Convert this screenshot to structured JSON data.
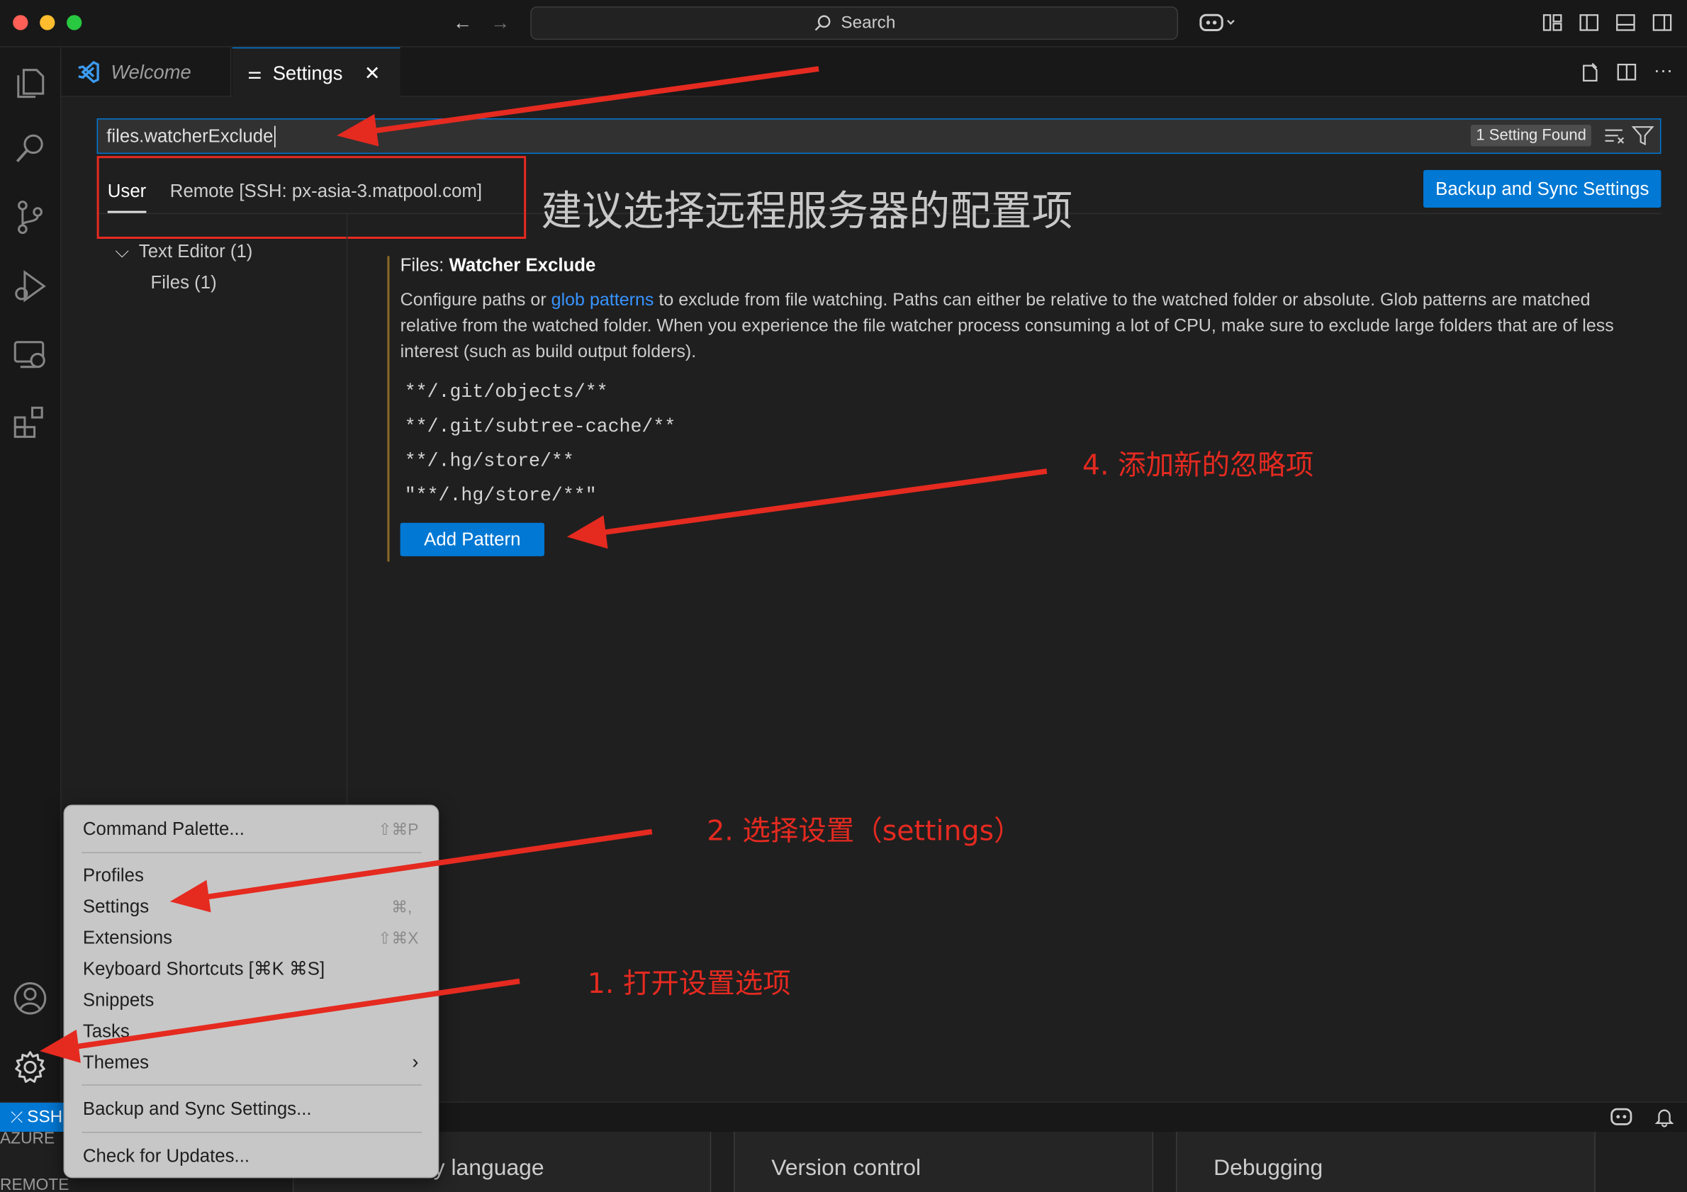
{
  "titlebar": {
    "search_label": "Search"
  },
  "tabs": [
    {
      "label": "Welcome"
    },
    {
      "label": "Settings"
    }
  ],
  "settings": {
    "query": "files.watcherExclude",
    "found": "1 Setting Found",
    "scopes": {
      "user": "User",
      "remote": "Remote [SSH: px-asia-3.matpool.com]"
    },
    "backup_button": "Backup and Sync Settings",
    "toc": {
      "text_editor": "Text Editor (1)",
      "files": "Files (1)"
    },
    "setting": {
      "title_prefix": "Files: ",
      "title": "Watcher Exclude",
      "desc_1": "Configure paths or ",
      "desc_link": "glob patterns",
      "desc_2": " to exclude from file watching. Paths can either be relative to the watched folder or absolute. Glob patterns are matched relative from the watched folder. When you experience the file watcher process consuming a lot of CPU, make sure to exclude large folders that are of less interest (such as build output folders).",
      "patterns": [
        "**/.git/objects/**",
        "**/.git/subtree-cache/**",
        "**/.hg/store/**",
        "\"**/.hg/store/**\""
      ],
      "add_button": "Add Pattern"
    }
  },
  "menu": {
    "command_palette": {
      "label": "Command Palette...",
      "shortcut": "⇧⌘P"
    },
    "profiles": "Profiles",
    "settings": {
      "label": "Settings",
      "shortcut": "⌘,"
    },
    "extensions": {
      "label": "Extensions",
      "shortcut": "⇧⌘X"
    },
    "keyboard_shortcuts": "Keyboard Shortcuts [⌘K ⌘S]",
    "snippets": "Snippets",
    "tasks": "Tasks",
    "themes": "Themes",
    "backup_sync": "Backup and Sync Settings...",
    "check_updates": "Check for Updates..."
  },
  "statusbar": {
    "ssh": "SSH",
    "azure": "AZURE",
    "remote": "REMOTE"
  },
  "walkthrough": {
    "card1": "y language",
    "card2": "Version control",
    "card3": "Debugging"
  },
  "annotations": {
    "recommend": "建议选择远程服务器的配置项",
    "step4": "4. 添加新的忽略项",
    "step2": "2. 选择设置（settings）",
    "step1": "1. 打开设置选项"
  },
  "colors": {
    "accent": "#0078d4",
    "annotation_red": "#e52a20"
  }
}
